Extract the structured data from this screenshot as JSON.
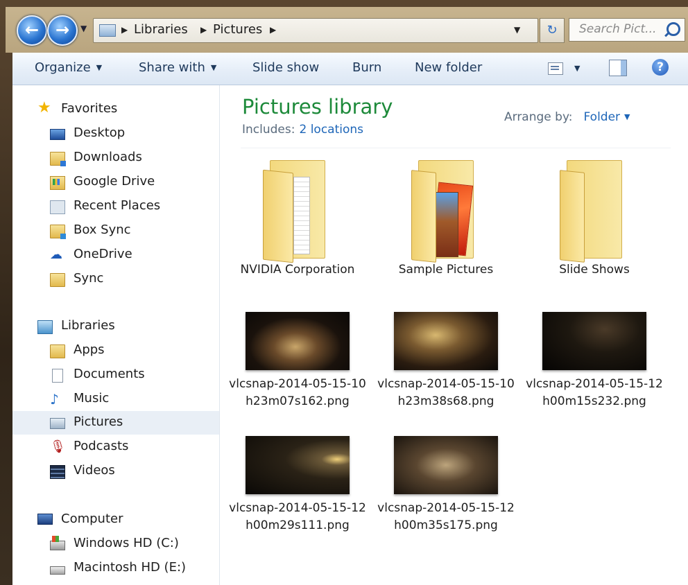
{
  "address": {
    "crumbs": [
      "Libraries",
      "Pictures"
    ],
    "search_placeholder": "Search Pict..."
  },
  "toolbar": {
    "organize": "Organize",
    "share_with": "Share with",
    "slide_show": "Slide show",
    "burn": "Burn",
    "new_folder": "New folder",
    "help_glyph": "?"
  },
  "nav": {
    "favorites": {
      "label": "Favorites",
      "items": [
        "Desktop",
        "Downloads",
        "Google Drive",
        "Recent Places",
        "Box Sync",
        "OneDrive",
        "Sync"
      ]
    },
    "libraries": {
      "label": "Libraries",
      "items": [
        "Apps",
        "Documents",
        "Music",
        "Pictures",
        "Podcasts",
        "Videos"
      ]
    },
    "computer": {
      "label": "Computer",
      "items": [
        "Windows HD (C:)",
        "Macintosh HD (E:)"
      ]
    }
  },
  "content": {
    "title": "Pictures library",
    "includes_label": "Includes:",
    "includes_link": "2 locations",
    "arrange_label": "Arrange by:",
    "arrange_value": "Folder",
    "folders": [
      "NVIDIA Corporation",
      "Sample Pictures",
      "Slide Shows"
    ],
    "files": [
      "vlcsnap-2014-05-15-10h23m07s162.png",
      "vlcsnap-2014-05-15-10h23m38s68.png",
      "vlcsnap-2014-05-15-12h00m15s232.png",
      "vlcsnap-2014-05-15-12h00m29s111.png",
      "vlcsnap-2014-05-15-12h00m35s175.png"
    ]
  },
  "colors": {
    "title_green": "#1d8a3a",
    "link_blue": "#1e66b8",
    "selected_bg": "#e9eff6"
  }
}
